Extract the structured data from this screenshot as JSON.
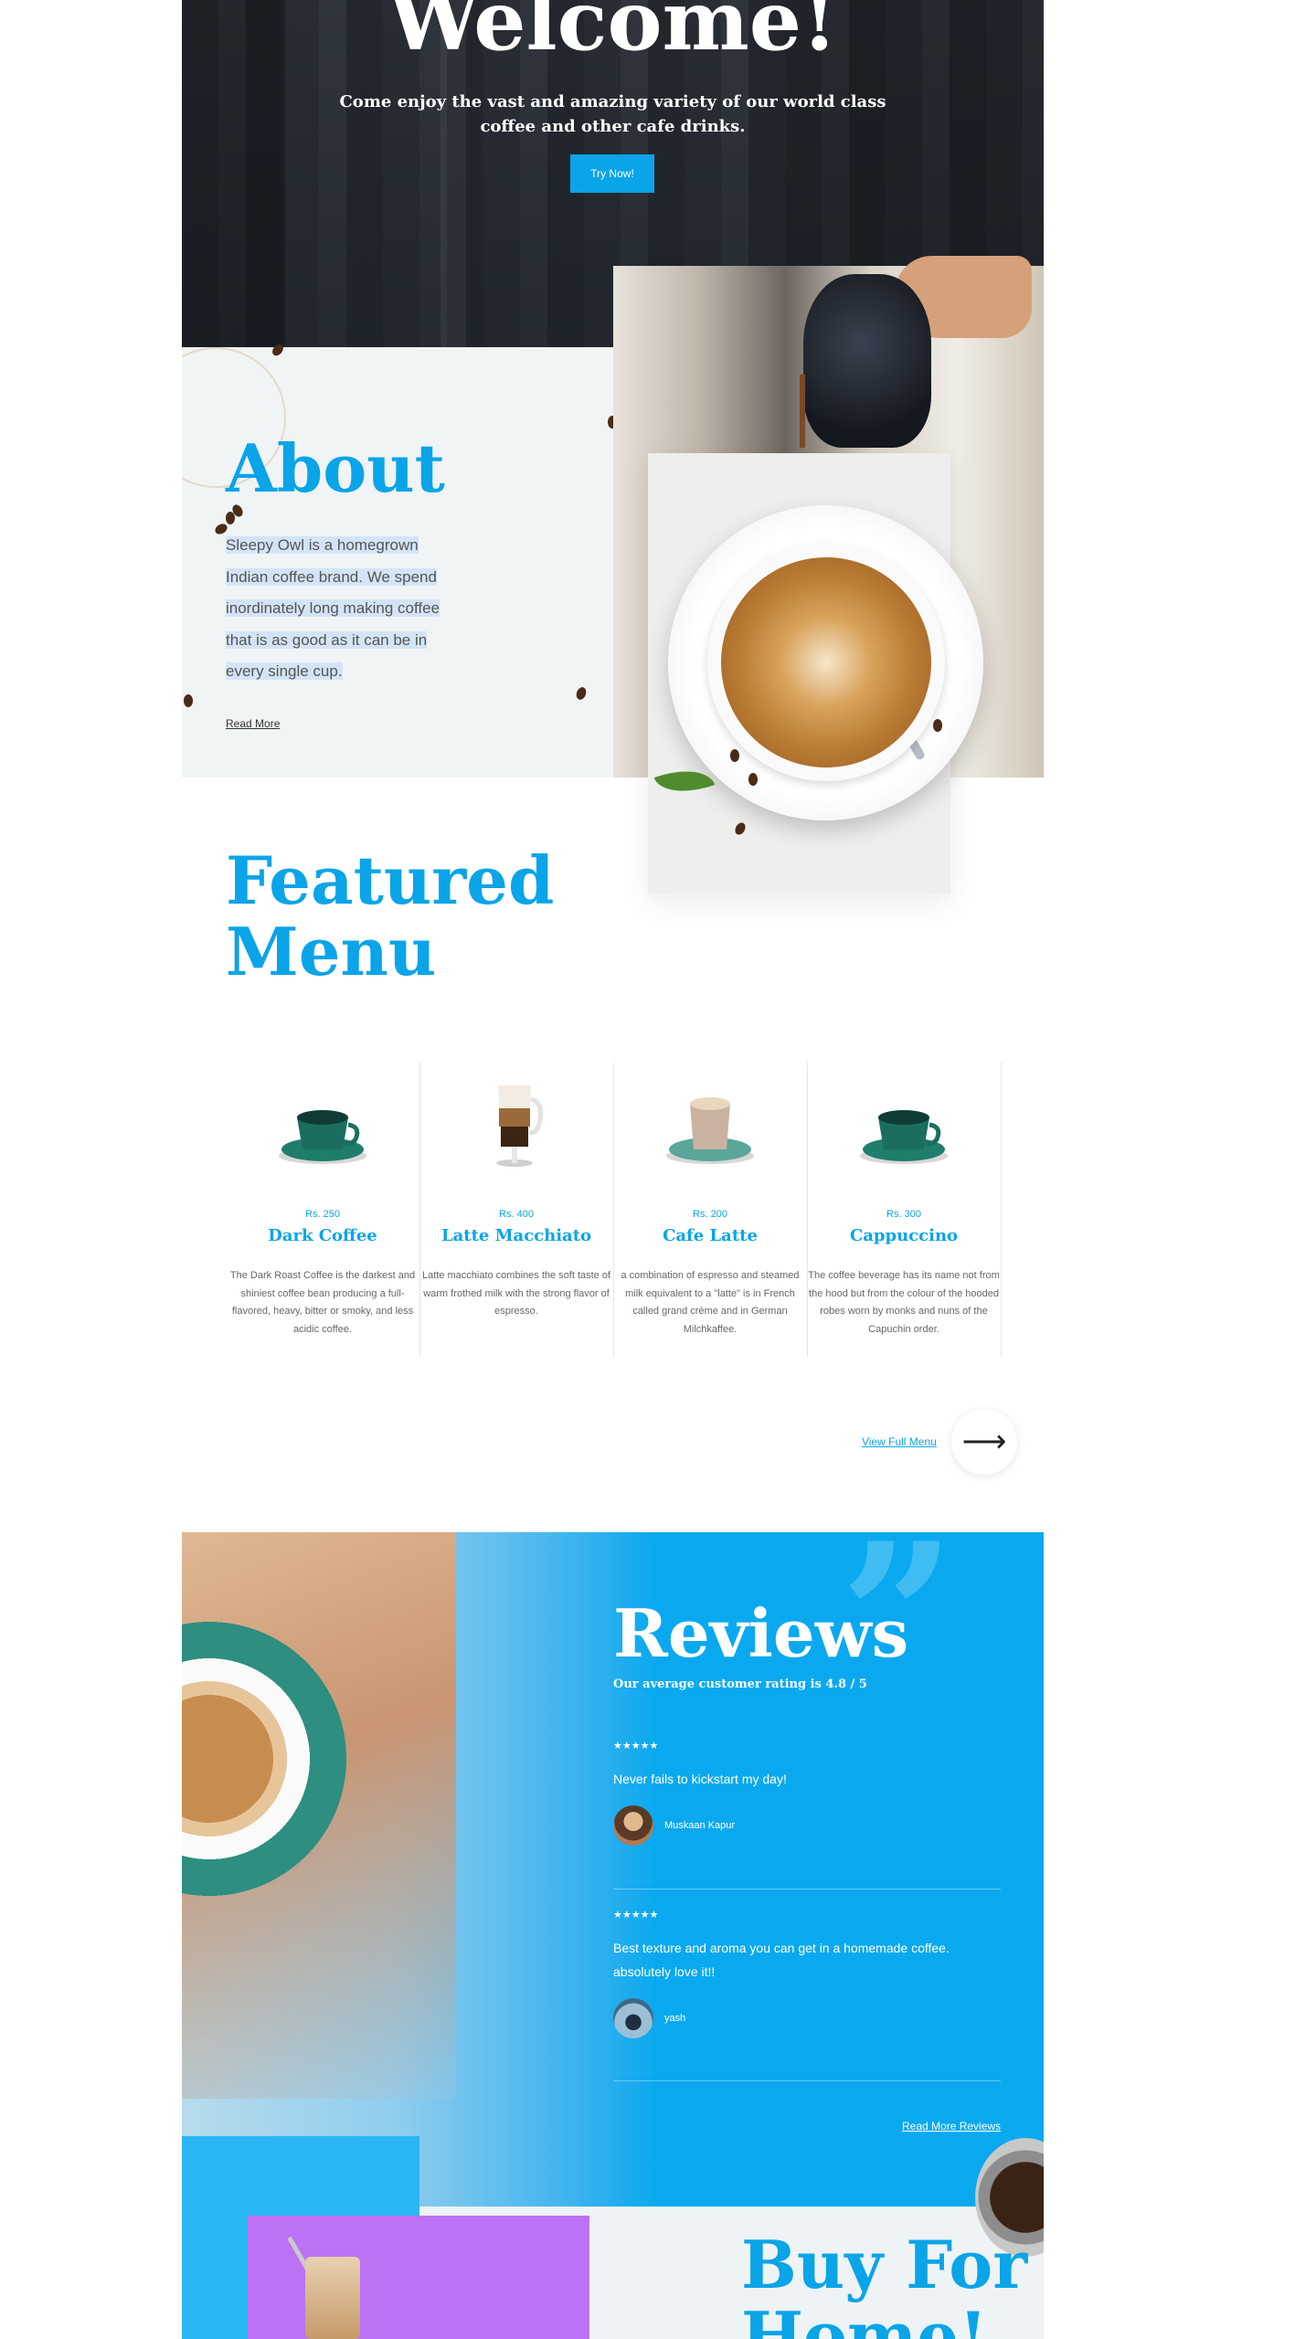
{
  "hero": {
    "title": "Welcome!",
    "subtitle": "Come enjoy the vast and amazing variety of our world class coffee and other cafe drinks.",
    "button": "Try Now!"
  },
  "about": {
    "title": "About",
    "text": "Sleepy Owl is a homegrown Indian coffee brand. We spend inordinately long making coffee that is as good as it can be in every single cup.",
    "read_more": "Read More"
  },
  "featured": {
    "title_line1": "Featured",
    "title_line2": "Menu",
    "items": [
      {
        "price": "Rs. 250",
        "name": "Dark Coffee",
        "desc": "The Dark Roast Coffee is the darkest and shiniest coffee bean producing a full-flavored, heavy, bitter or smoky, and less acidic coffee.",
        "icon": "teacup-icon"
      },
      {
        "price": "Rs. 400",
        "name": "Latte Macchiato",
        "desc": "Latte macchiato combines the soft taste of warm frothed milk with the strong flavor of espresso.",
        "icon": "latte-glass-icon"
      },
      {
        "price": "Rs. 200",
        "name": "Cafe Latte",
        "desc": "a combination of espresso and steamed milk equivalent to a \"latte\" is in French called grand crème and in German Milchkaffee.",
        "icon": "latte-cup-icon"
      },
      {
        "price": "Rs. 300",
        "name": "Cappuccino",
        "desc": "The coffee beverage has its name not from the hood but from the colour of the hooded robes worn by monks and nuns of the Capuchin order.",
        "icon": "teacup-icon"
      }
    ],
    "view_full_menu": "View Full Menu",
    "arrow": "⟶"
  },
  "reviews": {
    "title": "Reviews",
    "subtitle": "Our average customer rating is 4.8 / 5",
    "items": [
      {
        "stars": "★★★★★",
        "text": "Never fails to kickstart my day!",
        "name": "Muskaan Kapur"
      },
      {
        "stars": "★★★★★",
        "text": "Best texture and aroma you can get in a homemade coffee. absolutely love it!!",
        "name": "yash"
      }
    ],
    "read_more": "Read More Reviews",
    "quote": "”"
  },
  "buy": {
    "title_line1": "Buy For",
    "title_line2": "Home!"
  },
  "colors": {
    "accent": "#0aa4e8",
    "purple": "#bb72f5",
    "reviews_bg": "#0aa9ef"
  }
}
